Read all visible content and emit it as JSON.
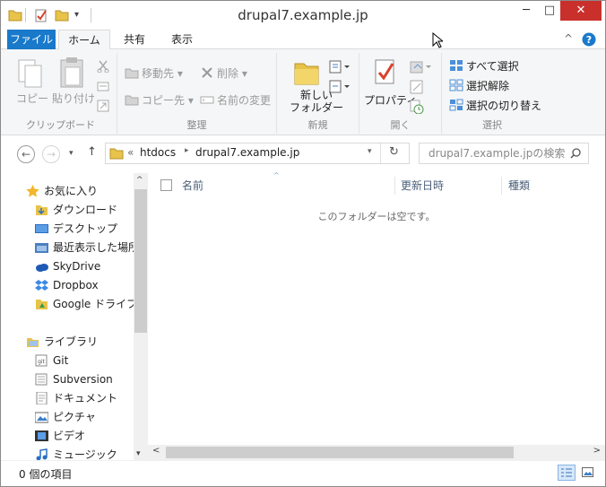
{
  "window": {
    "title": "drupal7.example.jp",
    "controls": {
      "minimize": "─",
      "maximize": "□",
      "close": "✕"
    }
  },
  "ribbon_tabs": {
    "file": "ファイル",
    "home": "ホーム",
    "share": "共有",
    "view": "表示"
  },
  "ribbon": {
    "clipboard": {
      "copy": "コピー",
      "paste": "貼り付け",
      "label": "クリップボード"
    },
    "organize": {
      "move_to": "移動先",
      "delete": "削除",
      "copy_to": "コピー先",
      "rename": "名前の変更",
      "label": "整理"
    },
    "new": {
      "new_folder_line1": "新しい",
      "new_folder_line2": "フォルダー",
      "label": "新規"
    },
    "open": {
      "properties": "プロパティ",
      "label": "開く"
    },
    "select": {
      "select_all": "すべて選択",
      "select_none": "選択解除",
      "invert": "選択の切り替え",
      "label": "選択"
    }
  },
  "address": {
    "overflow": "«",
    "segments": [
      "htdocs",
      "drupal7.example.jp"
    ]
  },
  "search": {
    "placeholder": "drupal7.example.jpの検索"
  },
  "nav": {
    "favorites": {
      "title": "お気に入り",
      "items": [
        "ダウンロード",
        "デスクトップ",
        "最近表示した場所",
        "SkyDrive",
        "Dropbox",
        "Google ドライブ"
      ]
    },
    "libraries": {
      "title": "ライブラリ",
      "items": [
        "Git",
        "Subversion",
        "ドキュメント",
        "ピクチャ",
        "ビデオ",
        "ミュージック"
      ]
    }
  },
  "columns": {
    "name": "名前",
    "modified": "更新日時",
    "type": "種類"
  },
  "empty_message": "このフォルダーは空です。",
  "status": {
    "items": "0 個の項目"
  },
  "colors": {
    "accent": "#1979ca",
    "close": "#c9302c",
    "folder": "#e8c34a"
  }
}
